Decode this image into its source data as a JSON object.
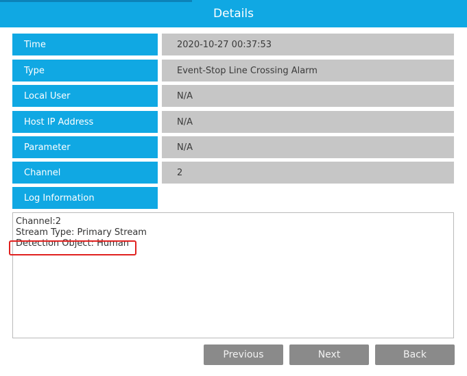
{
  "window": {
    "title": "Details"
  },
  "fields": [
    {
      "label": "Time",
      "value": "2020-10-27 00:37:53"
    },
    {
      "label": "Type",
      "value": "Event-Stop Line Crossing Alarm"
    },
    {
      "label": "Local User",
      "value": "N/A"
    },
    {
      "label": "Host IP Address",
      "value": "N/A"
    },
    {
      "label": "Parameter",
      "value": "N/A"
    },
    {
      "label": "Channel",
      "value": "2"
    }
  ],
  "log": {
    "label": "Log Information",
    "lines": [
      "Channel:2",
      "Stream Type: Primary Stream",
      "Detection Object: Human"
    ]
  },
  "buttons": {
    "previous": "Previous",
    "next": "Next",
    "back": "Back"
  },
  "colors": {
    "accent": "#10a8e3",
    "value_bg": "#c6c6c6",
    "button_bg": "#8a8a8a",
    "highlight": "#e0201e"
  }
}
